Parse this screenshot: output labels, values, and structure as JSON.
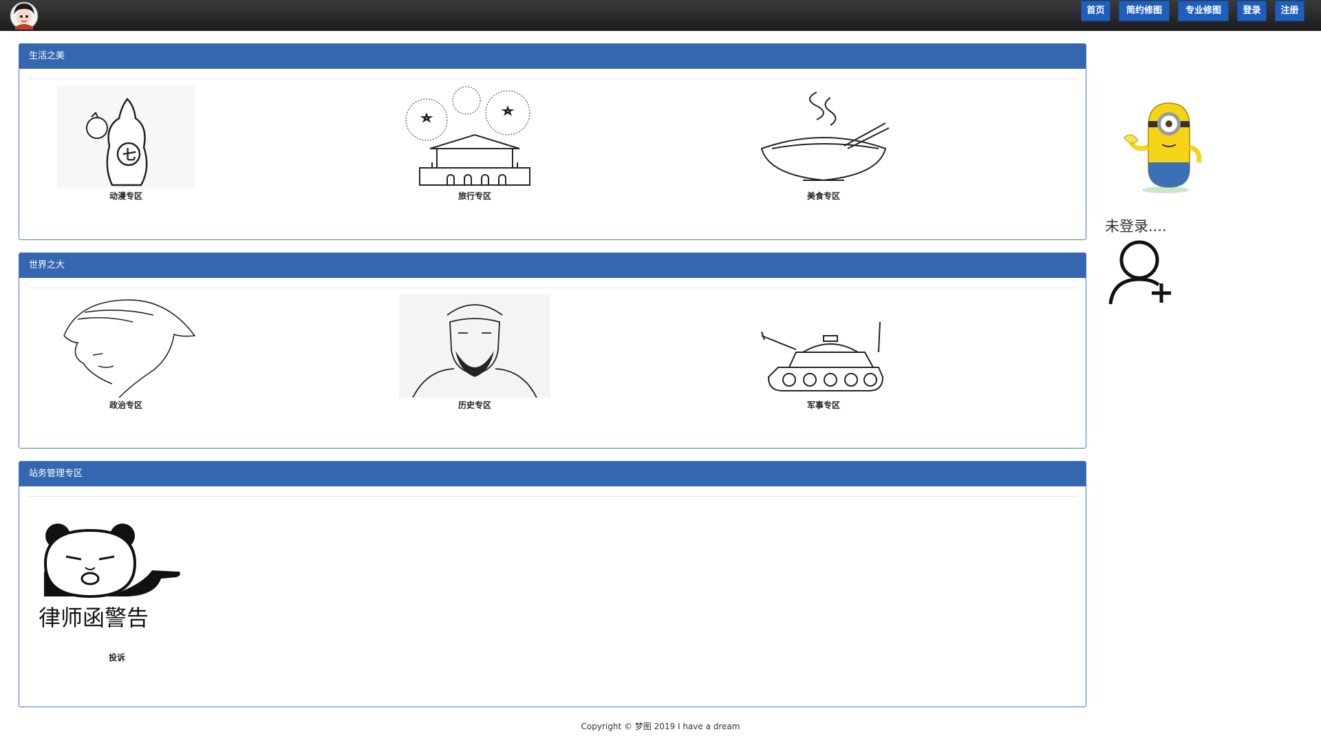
{
  "header": {
    "nav": [
      {
        "label": "首页"
      },
      {
        "label": "简约修图"
      },
      {
        "label": "专业修图"
      },
      {
        "label": "登录"
      },
      {
        "label": "注册"
      }
    ]
  },
  "sections": [
    {
      "title": "生活之美",
      "tiles": [
        {
          "label": "动漫专区",
          "icon": "anime-character-icon"
        },
        {
          "label": "旅行专区",
          "icon": "tiananmen-fireworks-icon"
        },
        {
          "label": "美食专区",
          "icon": "noodle-bowl-icon"
        }
      ]
    },
    {
      "title": "世界之大",
      "tiles": [
        {
          "label": "政治专区",
          "icon": "politician-portrait-icon"
        },
        {
          "label": "历史专区",
          "icon": "historical-figure-icon"
        },
        {
          "label": "军事专区",
          "icon": "tank-icon"
        }
      ]
    },
    {
      "title": "站务管理专区",
      "tiles": [
        {
          "label": "投诉",
          "icon": "panda-meme-icon",
          "caption": "律师函警告"
        }
      ]
    }
  ],
  "sidebar": {
    "status": "未登录....",
    "mascot": "minion-icon",
    "action_icon": "add-user-icon"
  },
  "footer": {
    "text": "Copyright © 梦图 2019 I have a dream"
  },
  "colors": {
    "topbar": "#262626",
    "nav_button": "#1e5fbd",
    "panel_header": "#3467b0",
    "panel_border": "#3d78c7"
  }
}
